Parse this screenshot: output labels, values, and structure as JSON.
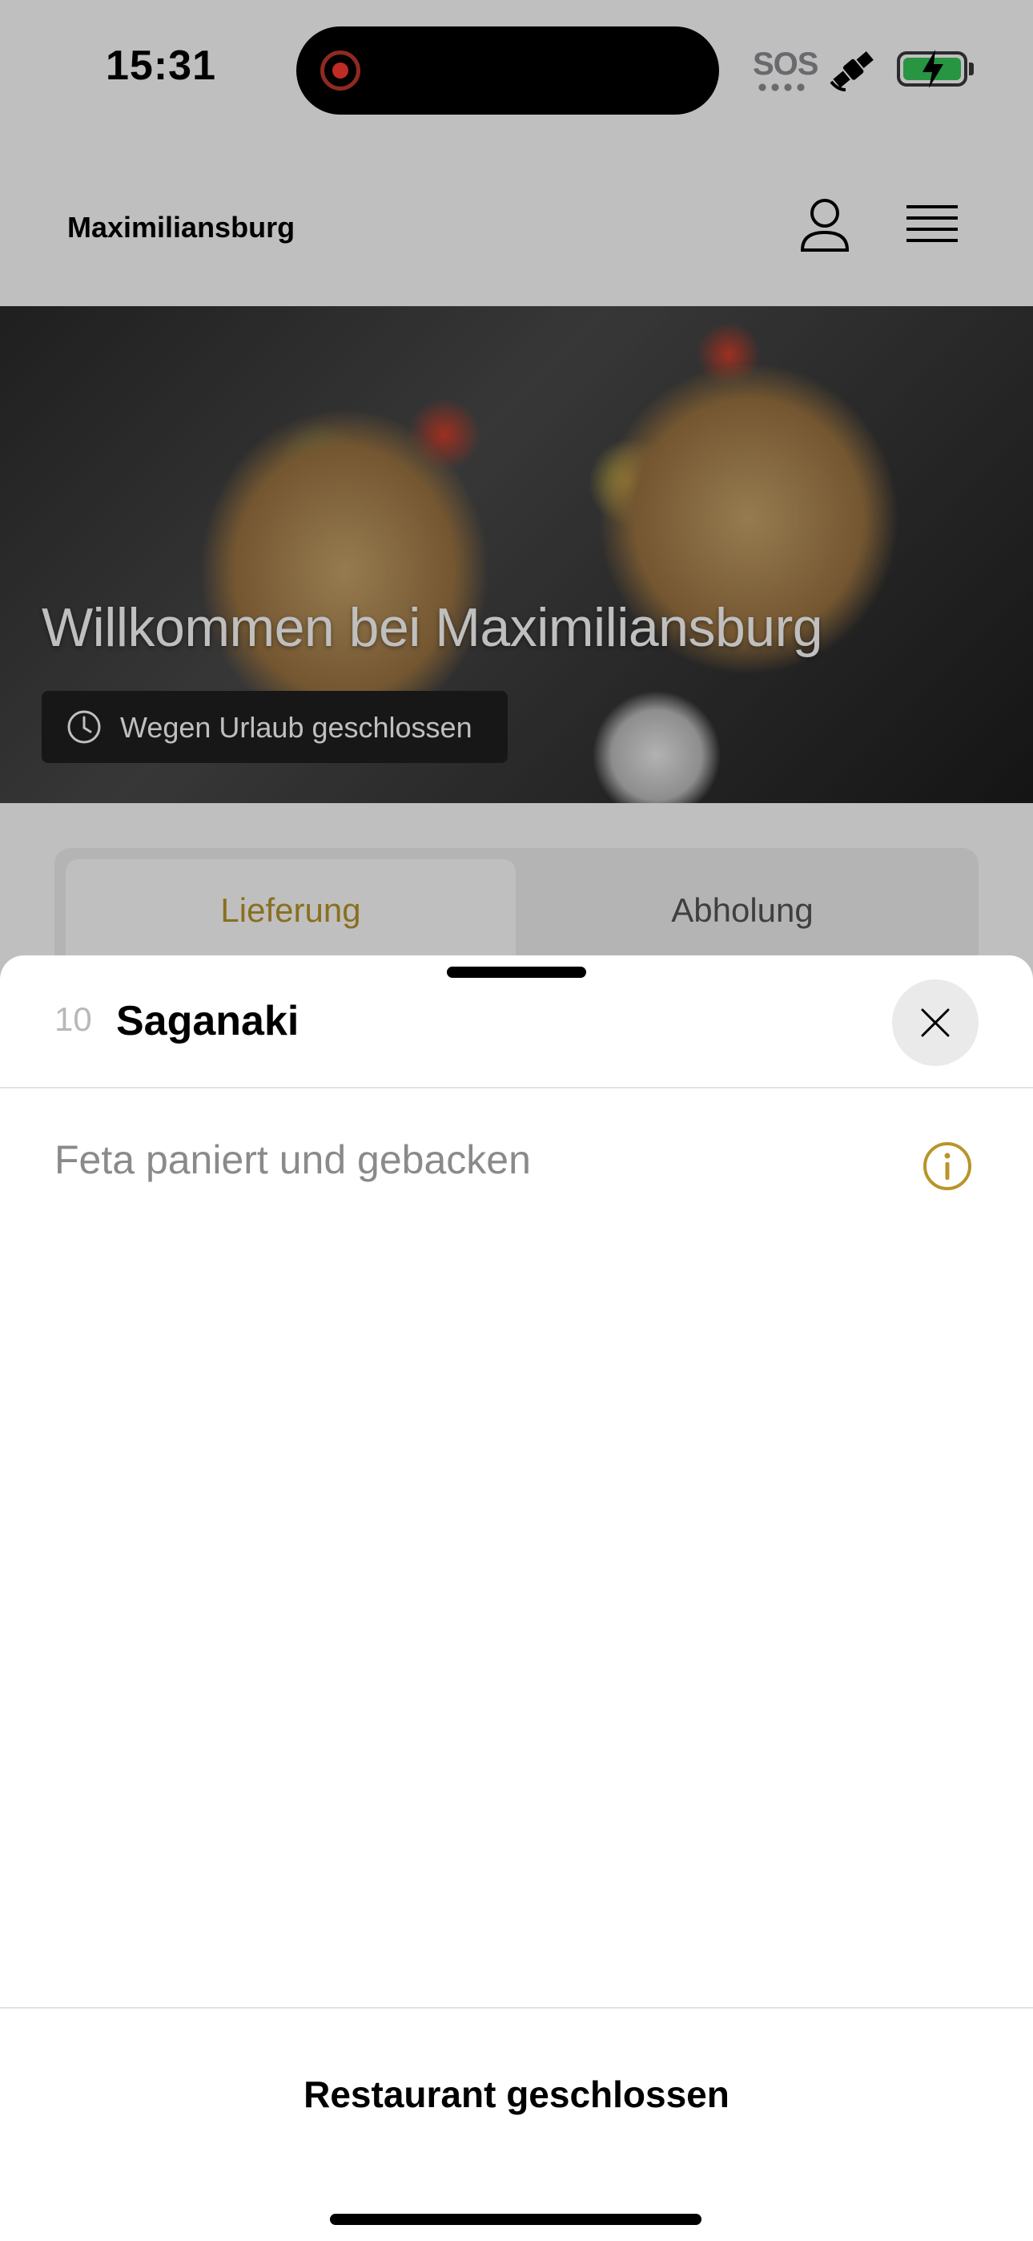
{
  "status_bar": {
    "time": "15:31",
    "sos": "SOS",
    "icons": [
      "screen-recording-icon",
      "satellite-icon",
      "battery-charging-icon"
    ],
    "battery_color": "#34c759"
  },
  "header": {
    "brand": "Maximiliansburg",
    "icons": [
      "profile-icon",
      "menu-icon"
    ]
  },
  "hero": {
    "title": "Willkommen bei Maximiliansburg",
    "status": "Wegen Urlaub geschlossen",
    "status_icon": "clock-icon"
  },
  "tabs": [
    {
      "label": "Lieferung",
      "active": true
    },
    {
      "label": "Abholung",
      "active": false
    }
  ],
  "sheet": {
    "item_number": "10",
    "item_name": "Saganaki",
    "description": "Feta paniert und gebacken",
    "close_icon": "close-icon",
    "info_icon": "info-icon",
    "footer_label": "Restaurant geschlossen"
  },
  "colors": {
    "accent": "#b8952a",
    "overlay": "rgba(0,0,0,0.25)"
  }
}
